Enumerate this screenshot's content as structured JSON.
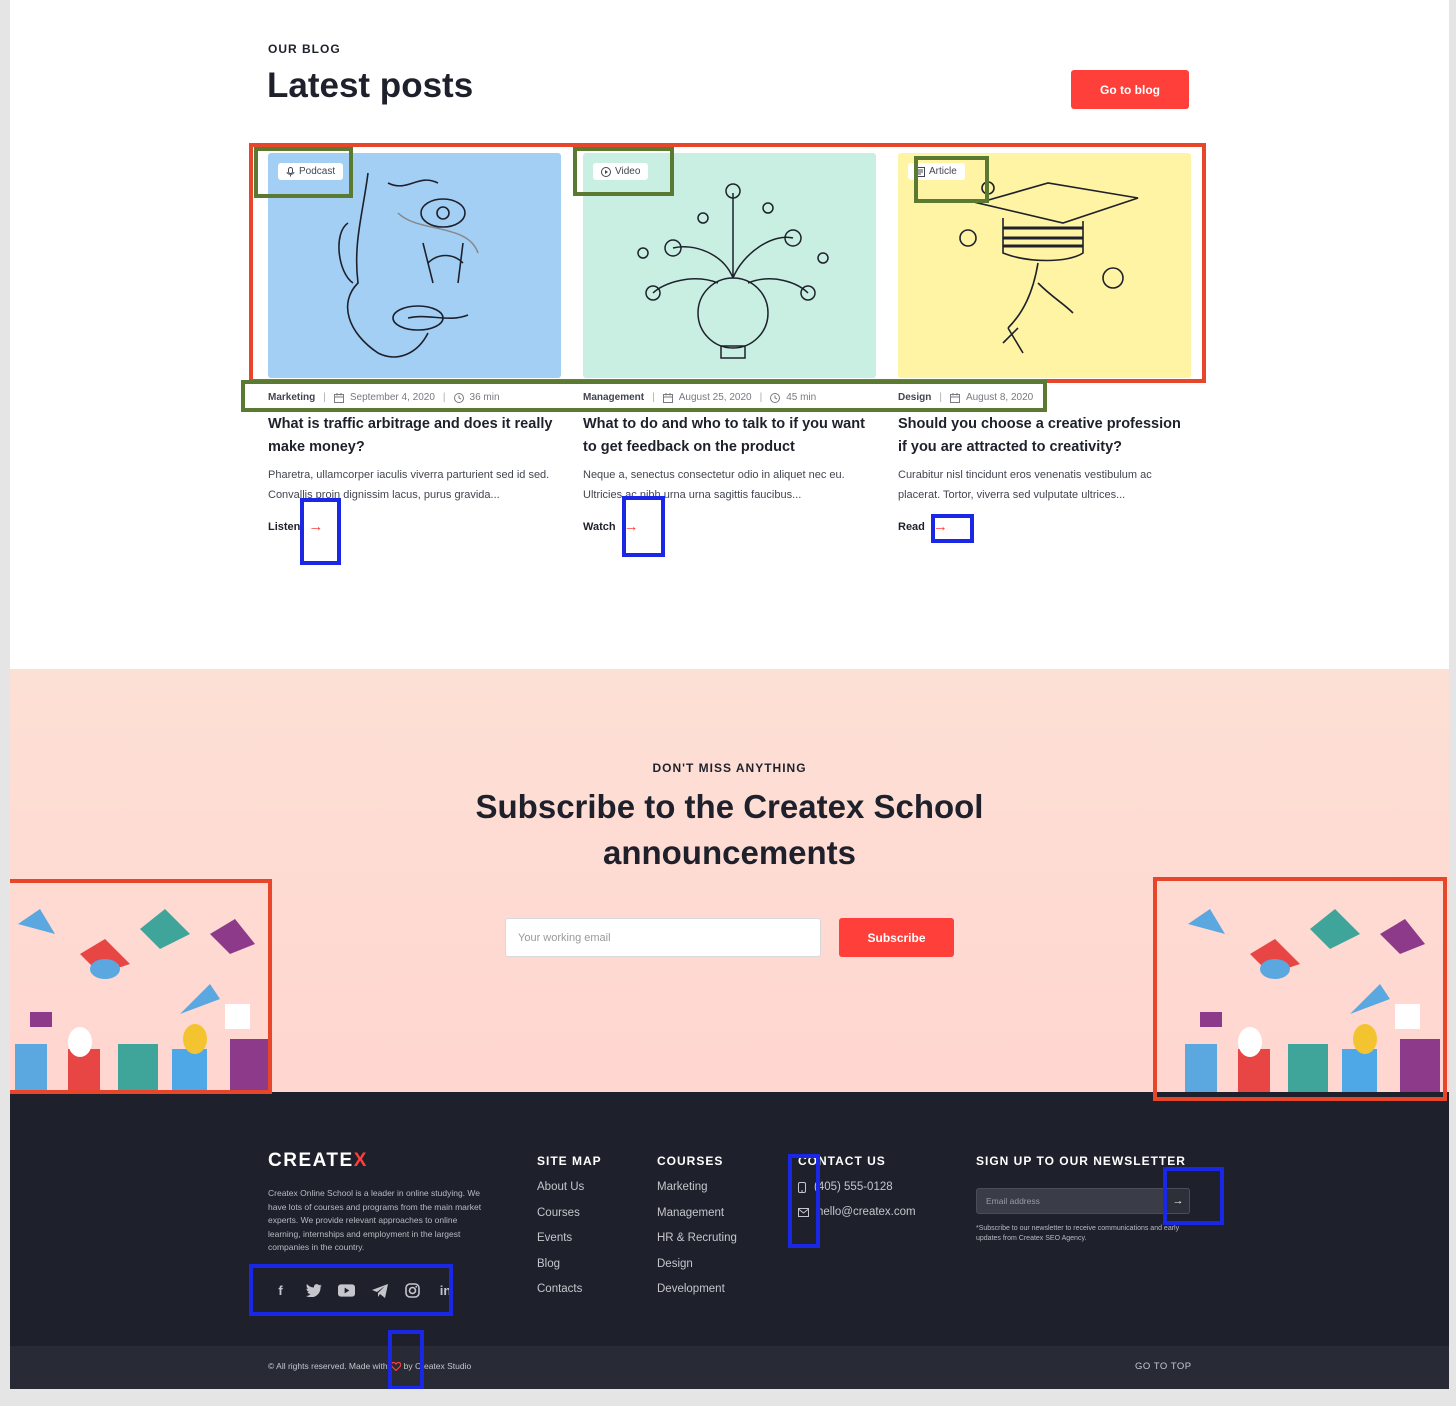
{
  "blog": {
    "eyebrow": "OUR BLOG",
    "title": "Latest posts",
    "go_button": "Go to blog",
    "posts": [
      {
        "badge": "Podcast",
        "category": "Marketing",
        "date": "September 4, 2020",
        "duration": "36 min",
        "title": "What is traffic arbitrage and does it really make money?",
        "excerpt": "Pharetra, ullamcorper iaculis viverra parturient sed id sed. Convallis proin dignissim lacus, purus gravida...",
        "link": "Listen",
        "bg": "#a4cff5"
      },
      {
        "badge": "Video",
        "category": "Management",
        "date": "August 25, 2020",
        "duration": "45 min",
        "title": "What to do and who to talk to if you want to get feedback on the product",
        "excerpt": "Neque a, senectus consectetur odio in aliquet nec eu. Ultricies ac nibh urna urna sagittis faucibus...",
        "link": "Watch",
        "bg": "#c8efe1"
      },
      {
        "badge": "Article",
        "category": "Design",
        "date": "August 8, 2020",
        "duration": "",
        "title": "Should you choose a creative profession if you are attracted to creativity?",
        "excerpt": "Curabitur nisl tincidunt eros venenatis vestibulum ac placerat. Tortor, viverra sed vulputate ultrices...",
        "link": "Read",
        "bg": "#fff3a4"
      }
    ]
  },
  "subscribe": {
    "eyebrow": "DON'T MISS ANYTHING",
    "title_line1": "Subscribe to the Createx School",
    "title_line2": "announcements",
    "email_placeholder": "Your working email",
    "button": "Subscribe"
  },
  "footer": {
    "logo_main": "CREATE",
    "logo_x": "X",
    "about": "Createx Online School is a leader in online studying. We have lots of courses and programs from the main market experts. We provide relevant approaches to online learning, internships and employment in the largest companies in the country.",
    "sitemap_title": "SITE MAP",
    "sitemap": [
      "About Us",
      "Courses",
      "Events",
      "Blog",
      "Contacts"
    ],
    "courses_title": "COURSES",
    "courses": [
      "Marketing",
      "Management",
      "HR & Recruting",
      "Design",
      "Development"
    ],
    "contact_title": "CONTACT US",
    "phone": "(405) 555-0128",
    "email": "hello@createx.com",
    "newsletter_title": "SIGN UP TO OUR NEWSLETTER",
    "newsletter_placeholder": "Email address",
    "newsletter_note": "*Subscribe to our newsletter to receive communications and early updates from Createx SEO Agency.",
    "copyright_pre": "© All rights reserved. Made with",
    "copyright_post": "by Createx Studio",
    "go_top": "GO TO TOP"
  },
  "colors": {
    "accent": "#ff3f3a",
    "dark": "#1e212c",
    "annotation_red": "#e8462a",
    "annotation_green": "#5a7a32",
    "annotation_blue": "#1a28e6"
  },
  "icons": [
    "microphone-icon",
    "play-icon",
    "document-icon",
    "calendar-icon",
    "clock-icon",
    "arrow-right-icon",
    "phone-icon",
    "mail-icon",
    "facebook-icon",
    "twitter-icon",
    "youtube-icon",
    "telegram-icon",
    "instagram-icon",
    "linkedin-icon",
    "heart-icon"
  ]
}
